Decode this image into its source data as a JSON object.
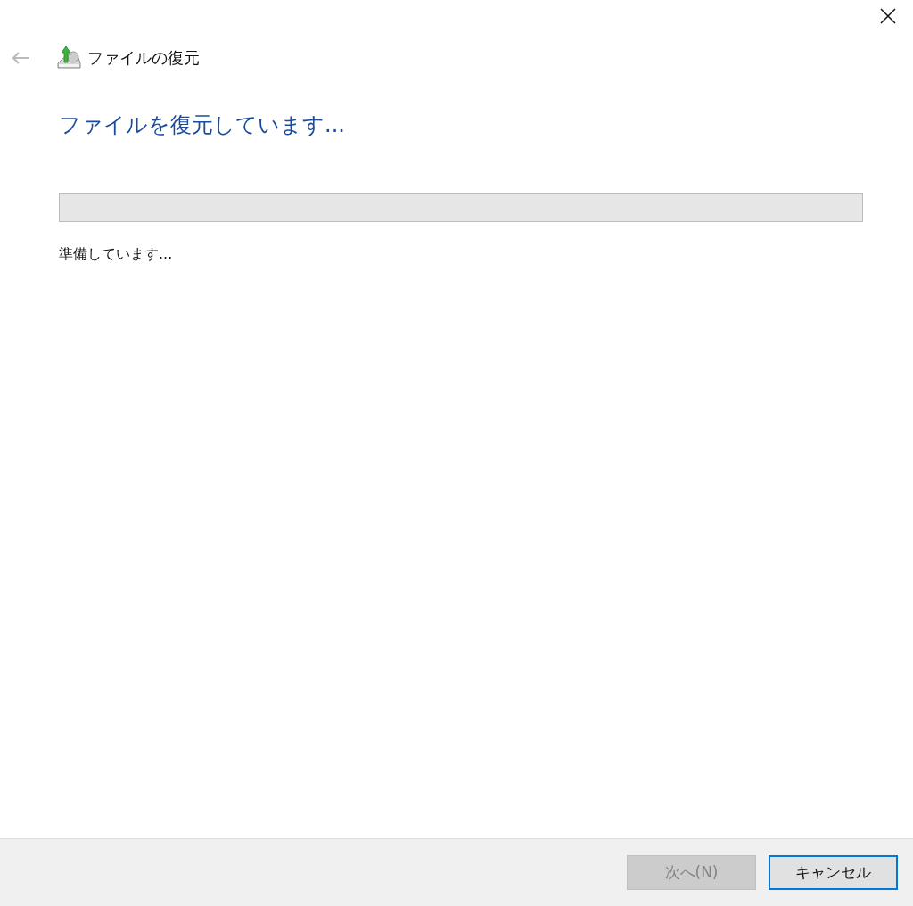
{
  "window": {
    "title": "ファイルの復元",
    "back_disabled": true
  },
  "heading": "ファイルを復元しています...",
  "progress": {
    "level": 0
  },
  "status": "準備しています...",
  "buttons": [
    {
      "label": "次へ(N)",
      "disabled": true,
      "focused": false
    },
    {
      "label": "キャンセル",
      "disabled": false,
      "focused": true
    }
  ]
}
